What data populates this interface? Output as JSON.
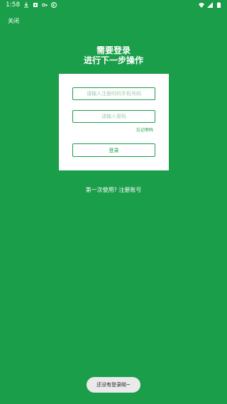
{
  "status_bar": {
    "time": "1:58",
    "icons": [
      "download-icon",
      "sim-icon",
      "key-icon",
      "vpn-icon"
    ],
    "right_icons": [
      "wifi-icon",
      "signal-icon",
      "battery-icon"
    ]
  },
  "header": {
    "close_label": "关闭"
  },
  "headline": {
    "line1": "需要登录",
    "line2": "进行下一步操作"
  },
  "form": {
    "account_placeholder": "请输入注册时的手机号码",
    "password_placeholder": "请输入密码",
    "forgot_label": "忘记密码",
    "login_label": "登录"
  },
  "register": {
    "prompt": "第一次使用?",
    "link": "注册账号"
  },
  "toast": {
    "message": "还没有登录呦~"
  },
  "colors": {
    "background": "#1a9e49",
    "card": "#ffffff",
    "accent": "#1a9e49"
  }
}
